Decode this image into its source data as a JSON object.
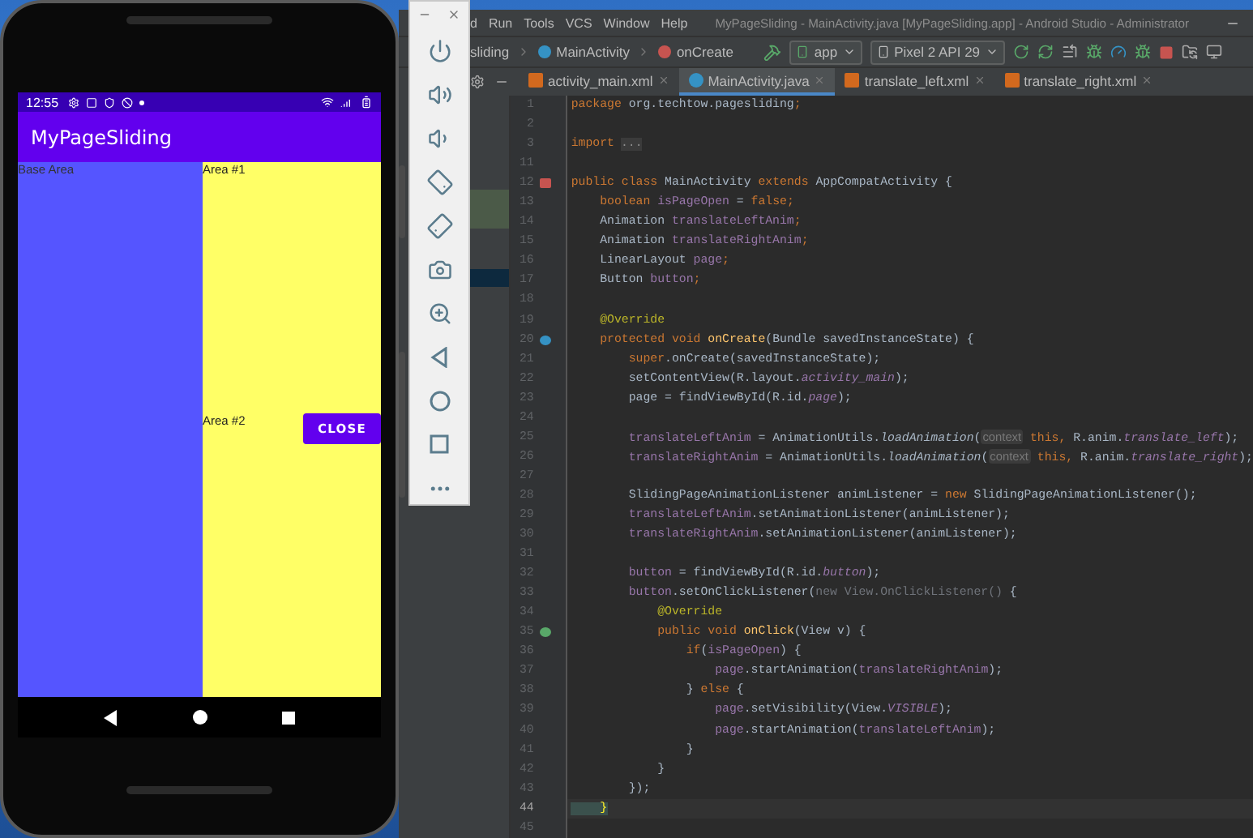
{
  "phone": {
    "status_time": "12:55",
    "app_title": "MyPageSliding",
    "base_area_label": "Base Area",
    "area_1_label": "Area #1",
    "area_2_label": "Area #2",
    "close_button": "CLOSE"
  },
  "ide": {
    "menu": [
      "d",
      "Run",
      "Tools",
      "VCS",
      "Window",
      "Help"
    ],
    "window_title": "MyPageSliding - MainActivity.java [MyPageSliding.app] - Android Studio - Administrator",
    "breadcrumbs": [
      {
        "label": "sliding",
        "kind": "text"
      },
      {
        "label": "MainActivity",
        "kind": "class"
      },
      {
        "label": "onCreate",
        "kind": "method"
      }
    ],
    "run_config": "app",
    "device": "Pixel 2 API 29",
    "tabs": [
      {
        "label": "activity_main.xml",
        "kind": "xml",
        "selected": false
      },
      {
        "label": "MainActivity.java",
        "kind": "java",
        "selected": true
      },
      {
        "label": "translate_left.xml",
        "kind": "xml",
        "selected": false
      },
      {
        "label": "translate_right.xml",
        "kind": "xml",
        "selected": false
      }
    ],
    "code": [
      {
        "number": "1",
        "kind": "plain",
        "current": false,
        "tokens": [
          {
            "text": "package",
            "kind": "keyword"
          },
          {
            "text": " org.techtow.pagesliding",
            "kind": "plain"
          },
          {
            "text": ";",
            "kind": "keyword"
          }
        ]
      },
      {
        "number": "2",
        "kind": "plain",
        "current": false
      },
      {
        "number": "3",
        "kind": "plain",
        "current": false,
        "tokens": [
          {
            "text": "import",
            "kind": "keyword"
          },
          {
            "text": "...",
            "kind": "fold"
          }
        ]
      },
      {
        "number": "11",
        "kind": "plain",
        "current": false
      },
      {
        "number": "12",
        "kind": "class",
        "current": false,
        "tokens": [
          {
            "text": "public class ",
            "kind": "keyword"
          },
          {
            "text": "MainActivity ",
            "kind": "plain"
          },
          {
            "text": "extends ",
            "kind": "keyword"
          },
          {
            "text": "AppCompatActivity {",
            "kind": "plain"
          }
        ]
      },
      {
        "number": "13",
        "kind": "plain",
        "current": false,
        "tokens": [
          {
            "text": "    boolean ",
            "kind": "keyword"
          },
          {
            "text": "isPageOpen",
            "kind": "field"
          },
          {
            "text": " = ",
            "kind": "plain"
          },
          {
            "text": "false;",
            "kind": "keyword"
          }
        ]
      },
      {
        "number": "14",
        "kind": "plain",
        "current": false,
        "tokens": [
          {
            "text": "    Animation ",
            "kind": "plain"
          },
          {
            "text": "translateLeftAnim",
            "kind": "field"
          },
          {
            "text": ";",
            "kind": "keyword"
          }
        ]
      },
      {
        "number": "15",
        "kind": "plain",
        "current": false,
        "tokens": [
          {
            "text": "    Animation ",
            "kind": "plain"
          },
          {
            "text": "translateRightAnim",
            "kind": "field"
          },
          {
            "text": ";",
            "kind": "keyword"
          }
        ]
      },
      {
        "number": "16",
        "kind": "plain",
        "current": false,
        "tokens": [
          {
            "text": "    LinearLayout ",
            "kind": "plain"
          },
          {
            "text": "page",
            "kind": "field"
          },
          {
            "text": ";",
            "kind": "keyword"
          }
        ]
      },
      {
        "number": "17",
        "kind": "plain",
        "current": false,
        "tokens": [
          {
            "text": "    Button ",
            "kind": "plain"
          },
          {
            "text": "button",
            "kind": "field"
          },
          {
            "text": ";",
            "kind": "keyword"
          }
        ]
      },
      {
        "number": "18",
        "kind": "plain",
        "current": false
      },
      {
        "number": "19",
        "kind": "plain",
        "current": false,
        "tokens": [
          {
            "text": "    @Override",
            "kind": "annotation"
          }
        ]
      },
      {
        "number": "20",
        "kind": "override",
        "current": false,
        "tokens": [
          {
            "text": "    protected void ",
            "kind": "keyword"
          },
          {
            "text": "onCreate",
            "kind": "method"
          },
          {
            "text": "(Bundle savedInstanceState) {",
            "kind": "plain"
          }
        ]
      },
      {
        "number": "21",
        "kind": "plain",
        "current": false,
        "tokens": [
          {
            "text": "        super",
            "kind": "keyword"
          },
          {
            "text": ".onCreate(savedInstanceState);",
            "kind": "plain"
          }
        ]
      },
      {
        "number": "22",
        "kind": "plain",
        "current": false,
        "tokens": [
          {
            "text": "        setContentView(R.layout.",
            "kind": "plain"
          },
          {
            "text": "activity_main",
            "kind": "static_field"
          },
          {
            "text": ");",
            "kind": "plain"
          }
        ]
      },
      {
        "number": "23",
        "kind": "plain",
        "current": false,
        "tokens": [
          {
            "text": "        page = findViewById(R.id.",
            "kind": "plain"
          },
          {
            "text": "page",
            "kind": "static_field"
          },
          {
            "text": ");",
            "kind": "plain"
          }
        ]
      },
      {
        "number": "24",
        "kind": "plain",
        "current": false
      },
      {
        "number": "25",
        "kind": "plain",
        "current": false,
        "tokens": [
          {
            "text": "        translateLeftAnim",
            "kind": "field"
          },
          {
            "text": " = AnimationUtils.",
            "kind": "plain"
          },
          {
            "text": "loadAnimation",
            "kind": "static_method"
          },
          {
            "text": "(",
            "kind": "plain"
          },
          {
            "text": "context",
            "kind": "hint"
          },
          {
            "text": " this, ",
            "kind": "keyword"
          },
          {
            "text": "R.anim.",
            "kind": "plain"
          },
          {
            "text": "translate_left",
            "kind": "static_field"
          },
          {
            "text": ");",
            "kind": "plain"
          }
        ]
      },
      {
        "number": "26",
        "kind": "plain",
        "current": false,
        "tokens": [
          {
            "text": "        translateRightAnim",
            "kind": "field"
          },
          {
            "text": " = AnimationUtils.",
            "kind": "plain"
          },
          {
            "text": "loadAnimation",
            "kind": "static_method"
          },
          {
            "text": "(",
            "kind": "plain"
          },
          {
            "text": "context",
            "kind": "hint"
          },
          {
            "text": " this, ",
            "kind": "keyword"
          },
          {
            "text": "R.anim.",
            "kind": "plain"
          },
          {
            "text": "translate_right",
            "kind": "static_field"
          },
          {
            "text": ");",
            "kind": "plain"
          }
        ]
      },
      {
        "number": "27",
        "kind": "plain",
        "current": false
      },
      {
        "number": "28",
        "kind": "plain",
        "current": false,
        "tokens": [
          {
            "text": "        SlidingPageAnimationListener animListener = ",
            "kind": "plain"
          },
          {
            "text": "new ",
            "kind": "keyword"
          },
          {
            "text": "SlidingPageAnimationListener();",
            "kind": "plain"
          }
        ]
      },
      {
        "number": "29",
        "kind": "plain",
        "current": false,
        "tokens": [
          {
            "text": "        translateLeftAnim",
            "kind": "field"
          },
          {
            "text": ".setAnimationListener(animListener);",
            "kind": "plain"
          }
        ]
      },
      {
        "number": "30",
        "kind": "plain",
        "current": false,
        "tokens": [
          {
            "text": "        translateRightAnim",
            "kind": "field"
          },
          {
            "text": ".setAnimationListener(animListener);",
            "kind": "plain"
          }
        ]
      },
      {
        "number": "31",
        "kind": "plain",
        "current": false
      },
      {
        "number": "32",
        "kind": "plain",
        "current": false,
        "tokens": [
          {
            "text": "        button",
            "kind": "field"
          },
          {
            "text": " = findViewById(R.id.",
            "kind": "plain"
          },
          {
            "text": "button",
            "kind": "static_field"
          },
          {
            "text": ");",
            "kind": "plain"
          }
        ]
      },
      {
        "number": "33",
        "kind": "plain",
        "current": false,
        "tokens": [
          {
            "text": "        button",
            "kind": "field"
          },
          {
            "text": ".setOnClickListener(",
            "kind": "plain"
          },
          {
            "text": "new View.OnClickListener() ",
            "kind": "dim"
          },
          {
            "text": "{",
            "kind": "plain"
          }
        ]
      },
      {
        "number": "34",
        "kind": "plain",
        "current": false,
        "tokens": [
          {
            "text": "            @Override",
            "kind": "annotation"
          }
        ]
      },
      {
        "number": "35",
        "kind": "implements",
        "current": false,
        "tokens": [
          {
            "text": "            public void ",
            "kind": "keyword"
          },
          {
            "text": "onClick",
            "kind": "method"
          },
          {
            "text": "(View v) {",
            "kind": "plain"
          }
        ]
      },
      {
        "number": "36",
        "kind": "plain",
        "current": false,
        "tokens": [
          {
            "text": "                if",
            "kind": "keyword"
          },
          {
            "text": "(",
            "kind": "plain"
          },
          {
            "text": "isPageOpen",
            "kind": "field"
          },
          {
            "text": ") {",
            "kind": "plain"
          }
        ]
      },
      {
        "number": "37",
        "kind": "plain",
        "current": false,
        "tokens": [
          {
            "text": "                    page",
            "kind": "field"
          },
          {
            "text": ".startAnimation(",
            "kind": "plain"
          },
          {
            "text": "translateRightAnim",
            "kind": "field"
          },
          {
            "text": ");",
            "kind": "plain"
          }
        ]
      },
      {
        "number": "38",
        "kind": "plain",
        "current": false,
        "tokens": [
          {
            "text": "                } ",
            "kind": "plain"
          },
          {
            "text": "else ",
            "kind": "keyword"
          },
          {
            "text": "{",
            "kind": "plain"
          }
        ]
      },
      {
        "number": "39",
        "kind": "plain",
        "current": false,
        "tokens": [
          {
            "text": "                    page",
            "kind": "field"
          },
          {
            "text": ".setVisibility(View.",
            "kind": "plain"
          },
          {
            "text": "VISIBLE",
            "kind": "static_field"
          },
          {
            "text": ");",
            "kind": "plain"
          }
        ]
      },
      {
        "number": "40",
        "kind": "plain",
        "current": false,
        "tokens": [
          {
            "text": "                    page",
            "kind": "field"
          },
          {
            "text": ".startAnimation(",
            "kind": "plain"
          },
          {
            "text": "translateLeftAnim",
            "kind": "field"
          },
          {
            "text": ");",
            "kind": "plain"
          }
        ]
      },
      {
        "number": "41",
        "kind": "plain",
        "current": false,
        "tokens": [
          {
            "text": "                }",
            "kind": "plain"
          }
        ]
      },
      {
        "number": "42",
        "kind": "plain",
        "current": false,
        "tokens": [
          {
            "text": "            }",
            "kind": "plain"
          }
        ]
      },
      {
        "number": "43",
        "kind": "plain",
        "current": false,
        "tokens": [
          {
            "text": "        });",
            "kind": "plain"
          }
        ]
      },
      {
        "number": "44",
        "kind": "plain",
        "current": true,
        "tokens": [
          {
            "text": "    }",
            "kind": "brace"
          }
        ]
      },
      {
        "number": "45",
        "kind": "plain",
        "current": false
      }
    ]
  }
}
